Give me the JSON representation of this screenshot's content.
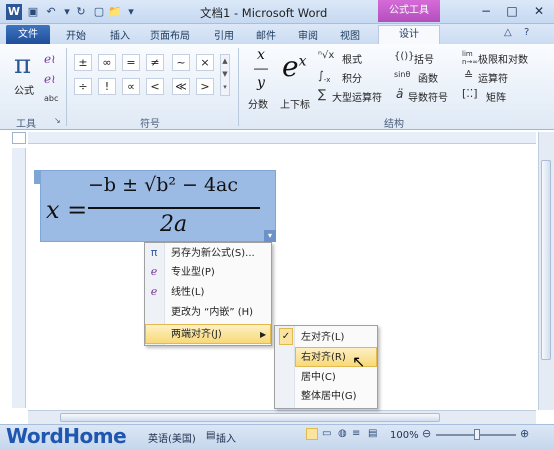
{
  "window": {
    "title": "文档1 - Microsoft Word",
    "context_tab": "公式工具",
    "buttons": [
      "−",
      "□",
      "✕"
    ]
  },
  "tabs": {
    "file": "文件",
    "items": [
      "开始",
      "插入",
      "页面布局",
      "引用",
      "邮件",
      "审阅",
      "视图"
    ],
    "active": "设计"
  },
  "ribbon": {
    "tools": {
      "formula_icon": "π",
      "formula_label": "公式",
      "label": "工具"
    },
    "symbols": {
      "label": "符号",
      "row1": [
        "±",
        "∞",
        "=",
        "≠",
        "~",
        "×"
      ],
      "row2": [
        "÷",
        "!",
        "∝",
        "<",
        "≪",
        ">"
      ]
    },
    "structures": {
      "label": "结构",
      "fraction_label": "分数",
      "script_label": "上下标",
      "radical_label": "根式",
      "integral_label": "积分",
      "large_operator_label": "大型运算符",
      "bracket_label": "括号",
      "function_label": "函数",
      "accent_label": "导数符号",
      "limit_label": "极限和对数",
      "operator_label": "运算符",
      "matrix_label": "矩阵"
    }
  },
  "equation": {
    "lhs": "x =",
    "numerator": "−b ± √b² − 4ac",
    "denominator": "2a"
  },
  "context_menu": {
    "items": [
      {
        "icon": "π",
        "label": "另存为新公式(S)..."
      },
      {
        "icon": "ℯ",
        "label": "专业型(P)"
      },
      {
        "icon": "ℯ",
        "label": "线性(L)"
      },
      {
        "icon": "",
        "label": "更改为 “内嵌” (H)"
      },
      {
        "icon": "",
        "label": "两端对齐(J)"
      }
    ]
  },
  "submenu": {
    "items": [
      {
        "label": "左对齐(L)",
        "checked": true
      },
      {
        "label": "右对齐(R)",
        "checked": false
      },
      {
        "label": "居中(C)",
        "checked": false
      },
      {
        "label": "整体居中(G)",
        "checked": false
      }
    ]
  },
  "statusbar": {
    "language": "英语(美国)",
    "mode": "插入",
    "zoom": "100%",
    "watermark": "WordHome"
  }
}
